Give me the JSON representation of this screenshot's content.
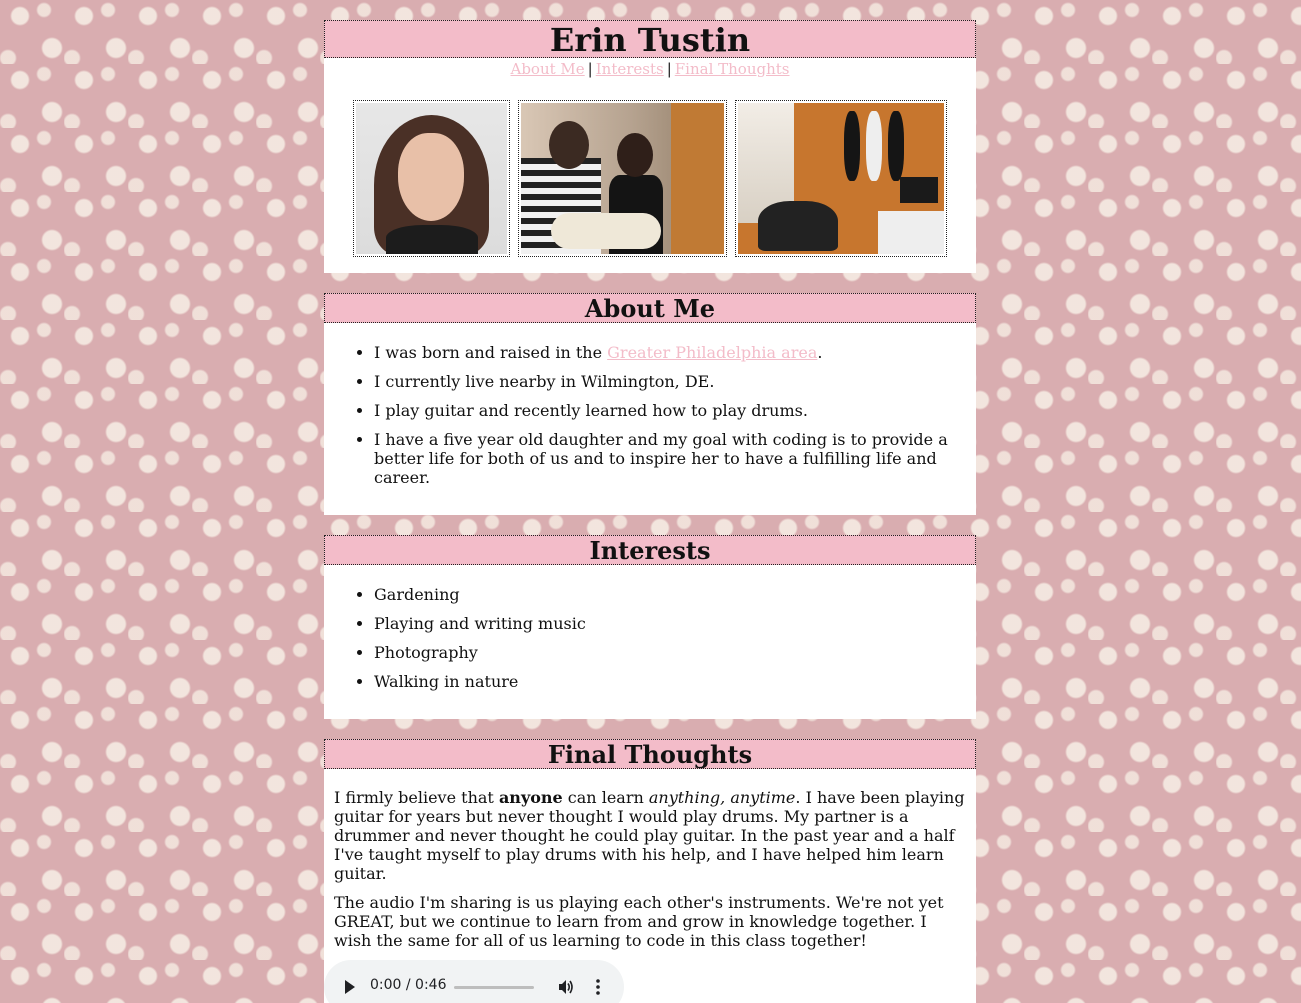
{
  "header": {
    "name": "Erin Tustin",
    "nav": {
      "about": "About Me",
      "interests": "Interests",
      "final": "Final Thoughts",
      "separator": "|"
    }
  },
  "about": {
    "title": "About Me",
    "items": [
      {
        "before": "I was born and raised in the ",
        "link": "Greater Philadelphia area",
        "after": "."
      },
      {
        "text": "I currently live nearby in Wilmington, DE."
      },
      {
        "text": "I play guitar and recently learned how to play drums."
      },
      {
        "text": "I have a five year old daughter and my goal with coding is to provide a better life for both of us and to inspire her to have a fulfilling life and career."
      }
    ]
  },
  "interests": {
    "title": "Interests",
    "items": [
      "Gardening",
      "Playing and writing music",
      "Photography",
      "Walking in nature"
    ]
  },
  "final": {
    "title": "Final Thoughts",
    "p1": {
      "a": "I firmly believe that ",
      "bold": "anyone",
      "b": " can learn ",
      "italic": "anything, anytime",
      "c": ". I have been playing guitar for years but never thought I would play drums. My partner is a drummer and never thought he could play guitar. In the past year and a half I've taught myself to play drums with his help, and I have helped him learn guitar."
    },
    "p2": "The audio I'm sharing is us playing each other's instruments. We're not yet GREAT, but we continue to learn from and grow in knowledge together. I wish the same for all of us learning to code in this class together!"
  },
  "audio": {
    "time": "0:00 / 0:46",
    "progress": 0
  },
  "colors": {
    "accent": "#f3bcc9",
    "page_bg": "#d9adb0",
    "dots": "#f4e8e0"
  },
  "icons": [
    "play-icon",
    "volume-icon",
    "more-options-icon"
  ]
}
